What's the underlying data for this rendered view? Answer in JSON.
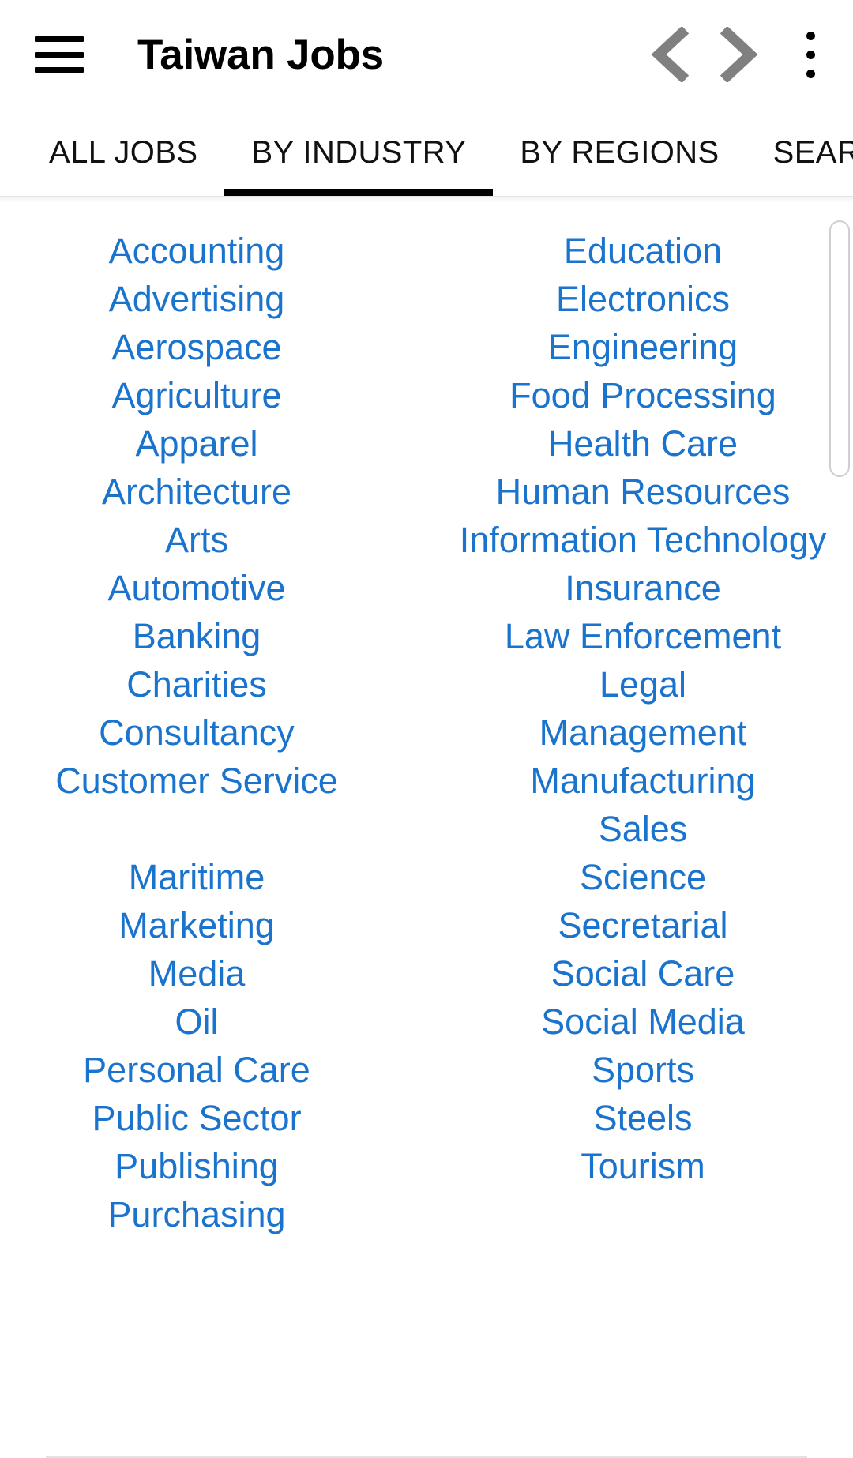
{
  "header": {
    "menu_icon": "hamburger-menu-icon",
    "title": "Taiwan Jobs",
    "back_icon": "chevron-left-icon",
    "forward_icon": "chevron-right-icon",
    "overflow_icon": "more-vertical-icon"
  },
  "tabs": [
    {
      "label": "ALL JOBS",
      "active": false
    },
    {
      "label": "BY INDUSTRY",
      "active": true
    },
    {
      "label": "BY REGIONS",
      "active": false
    },
    {
      "label": "SEARCH",
      "active": false
    }
  ],
  "industries": {
    "left_column": [
      "Accounting",
      "Advertising",
      "Aerospace",
      "Agriculture",
      "Apparel",
      "Architecture",
      "Arts",
      "Automotive",
      "Banking",
      "Charities",
      "Consultancy",
      "Customer Service",
      "",
      "Maritime",
      "Marketing",
      "Media",
      "Oil",
      "Personal Care",
      "Public Sector",
      "Publishing",
      "Purchasing"
    ],
    "right_column": [
      "Education",
      "Electronics",
      "Engineering",
      "Food Processing",
      "Health Care",
      "Human Resources",
      "Information Technology",
      "Insurance",
      "Law Enforcement",
      "Legal",
      "Management",
      "Manufacturing",
      "Sales",
      "Science",
      "Secretarial",
      "Social Care",
      "Social Media",
      "Sports",
      "Steels",
      "Tourism"
    ]
  },
  "colors": {
    "link": "#1a73cd",
    "tab_indicator": "#000000",
    "chevron": "#808080",
    "background": "#ffffff"
  }
}
